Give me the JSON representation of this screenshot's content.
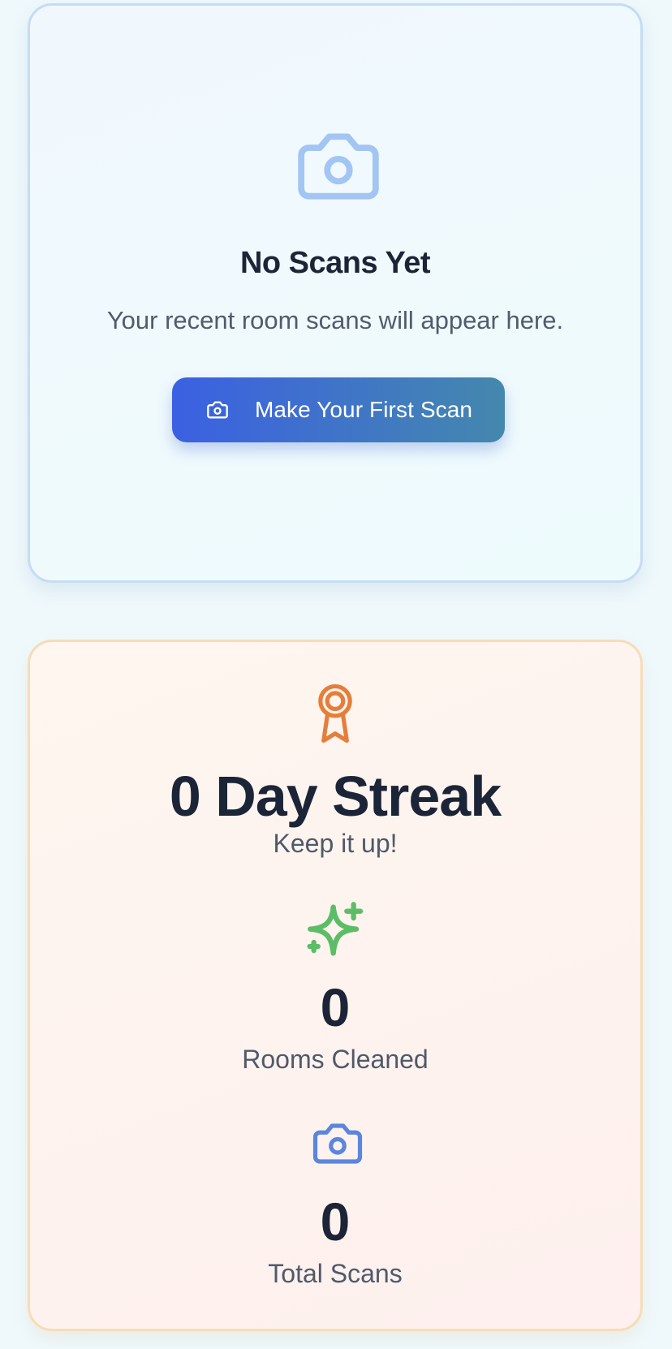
{
  "empty_state": {
    "icon": "camera-icon",
    "title": "No Scans Yet",
    "subtitle": "Your recent room scans will appear here.",
    "button": {
      "icon": "camera-icon",
      "label": "Make Your First Scan"
    }
  },
  "streak": {
    "icon": "award-icon",
    "title": "0 Day Streak",
    "subtitle": "Keep it up!"
  },
  "stats": {
    "rooms_cleaned": {
      "icon": "sparkles-icon",
      "value": "0",
      "label": "Rooms Cleaned"
    },
    "total_scans": {
      "icon": "camera-icon",
      "value": "0",
      "label": "Total Scans"
    }
  },
  "colors": {
    "background": "#eff9fc",
    "button_gradient_start": "#3b60e3",
    "button_gradient_end": "#4488ad",
    "empty_icon": "#a3c5f4",
    "award_icon": "#e67e3b",
    "sparkle_icon": "#5cbd67",
    "camera_icon_small": "#5b86de",
    "heading_text": "#1c2537",
    "body_text": "#515b6c"
  }
}
